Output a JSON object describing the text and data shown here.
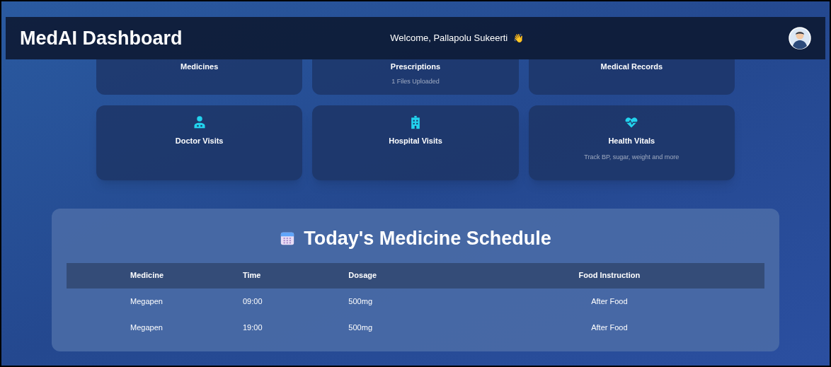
{
  "header": {
    "title": "MedAI Dashboard",
    "welcome": "Welcome, Pallapolu Sukeerti",
    "wave": "👋"
  },
  "top_cards": [
    {
      "title": "Medicines"
    },
    {
      "title": "Prescriptions",
      "subtitle": "1 Files Uploaded"
    },
    {
      "title": "Medical Records"
    }
  ],
  "cards": [
    {
      "kind": "doctor",
      "title": "Doctor Visits"
    },
    {
      "kind": "hospital",
      "title": "Hospital Visits"
    },
    {
      "kind": "heart",
      "title": "Health Vitals",
      "subtitle": "Track BP, sugar, weight and more"
    }
  ],
  "schedule": {
    "title": "Today's Medicine Schedule",
    "columns": [
      "Medicine",
      "Time",
      "Dosage",
      "Food Instruction"
    ],
    "rows": [
      [
        "Megapen",
        "09:00",
        "500mg",
        "After Food"
      ],
      [
        "Megapen",
        "19:00",
        "500mg",
        "After Food"
      ]
    ]
  }
}
